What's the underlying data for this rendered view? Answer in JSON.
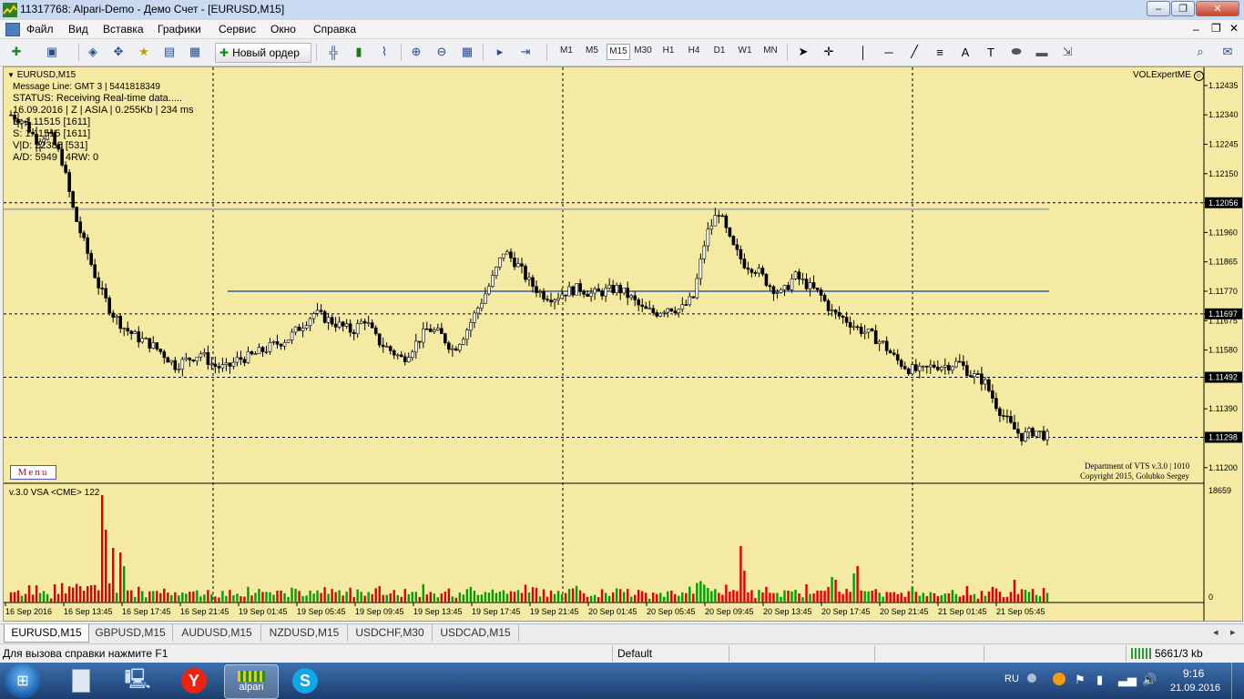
{
  "window": {
    "title": "11317768: Alpari-Demo - Демо Счет - [EURUSD,M15]"
  },
  "menu": [
    "Файл",
    "Вид",
    "Вставка",
    "Графики",
    "Сервис",
    "Окно",
    "Справка"
  ],
  "toolbar": {
    "new_order": "Новый ордер",
    "timeframes": [
      "M1",
      "M5",
      "M15",
      "M30",
      "H1",
      "H4",
      "D1",
      "W1",
      "MN"
    ],
    "active_timeframe": "M15"
  },
  "chart": {
    "symbol_label": "EURUSD,M15",
    "info_lines": [
      "Message Line: GMT 3 | 5441818349",
      "STATUS:  Receiving Real-time data.....",
      "16.09.2016 | Z | ASIA | 0.255Kb | 234 ms",
      "B: 1.11515  [1611]",
      "S: 1.11515 [1611]",
      "V|D: 22386 [531]",
      "A/D: 5949 | 4RW: 0"
    ],
    "expert_label": "VOLExpertME",
    "menu_button": "Menu",
    "credit_line1": "Department of VTS  v.3.0 | 1010",
    "credit_line2": "Copyright 2015, Golubko Sergey",
    "indicator_label": "v.3.0 VSA <CME> 122",
    "volume_scale_top": "18659",
    "volume_scale_bottom": "0",
    "colors": {
      "background": "#f4eaa3",
      "candle": "#000000",
      "level_line": "#3a5aa8",
      "bull_volume": "#00a000",
      "bear_volume": "#e00000"
    }
  },
  "chart_data": {
    "type": "candlestick",
    "price_ticks": [
      "1.12435",
      "1.12340",
      "1.12245",
      "1.12150",
      "1.12056",
      "1.11960",
      "1.11865",
      "1.11770",
      "1.11697",
      "1.11675",
      "1.11580",
      "1.11492",
      "1.11390",
      "1.11298",
      "1.11200"
    ],
    "highlighted_prices": [
      "1.12056",
      "1.11697",
      "1.11492",
      "1.11298"
    ],
    "ylim": [
      1.1117,
      1.1247
    ],
    "time_labels": [
      "16 Sep 2016",
      "16 Sep 13:45",
      "16 Sep 17:45",
      "16 Sep 21:45",
      "19 Sep 01:45",
      "19 Sep 05:45",
      "19 Sep 09:45",
      "19 Sep 13:45",
      "19 Sep 17:45",
      "19 Sep 21:45",
      "20 Sep 01:45",
      "20 Sep 05:45",
      "20 Sep 09:45",
      "20 Sep 13:45",
      "20 Sep 17:45",
      "20 Sep 21:45",
      "21 Sep 01:45",
      "21 Sep 05:45"
    ],
    "horizontal_levels": [
      {
        "price": 1.12056,
        "style": "dashed"
      },
      {
        "price": 1.11697,
        "style": "dashed"
      },
      {
        "price": 1.11492,
        "style": "dashed"
      },
      {
        "price": 1.11298,
        "style": "dashed"
      },
      {
        "price": 1.1177,
        "style": "solid-blue"
      },
      {
        "price": 1.12035,
        "style": "solid-gray"
      }
    ],
    "close_path": [
      1.1234,
      1.1232,
      1.1226,
      1.1228,
      1.122,
      1.1202,
      1.119,
      1.1178,
      1.117,
      1.1165,
      1.1162,
      1.116,
      1.1157,
      1.1153,
      1.1155,
      1.1157,
      1.1153,
      1.1152,
      1.1155,
      1.1156,
      1.1158,
      1.116,
      1.1162,
      1.1166,
      1.117,
      1.1168,
      1.1166,
      1.1164,
      1.1168,
      1.1161,
      1.1158,
      1.1155,
      1.116,
      1.1165,
      1.1163,
      1.1158,
      1.1164,
      1.1172,
      1.118,
      1.119,
      1.1186,
      1.118,
      1.1176,
      1.1175,
      1.1177,
      1.1178,
      1.1176,
      1.1177,
      1.1178,
      1.1175,
      1.1171,
      1.117,
      1.1172,
      1.1171,
      1.1175,
      1.1195,
      1.1203,
      1.1192,
      1.1186,
      1.1184,
      1.1179,
      1.1176,
      1.1182,
      1.1179,
      1.1176,
      1.117,
      1.1168,
      1.1165,
      1.1163,
      1.116,
      1.1155,
      1.1152,
      1.1151,
      1.1153,
      1.1153,
      1.1154,
      1.115,
      1.1148,
      1.114,
      1.1134,
      1.113,
      1.1132,
      1.113
    ]
  },
  "tabs": [
    "EURUSD,M15",
    "GBPUSD,M15",
    "AUDUSD,M15",
    "NZDUSD,M15",
    "USDCHF,M30",
    "USDCAD,M15"
  ],
  "status": {
    "help": "Для вызова справки нажмите F1",
    "profile": "Default",
    "traffic": "5661/3 kb"
  },
  "taskbar": {
    "apps": [
      "alpari"
    ],
    "lang": "RU",
    "time": "9:16",
    "date": "21.09.2016"
  }
}
